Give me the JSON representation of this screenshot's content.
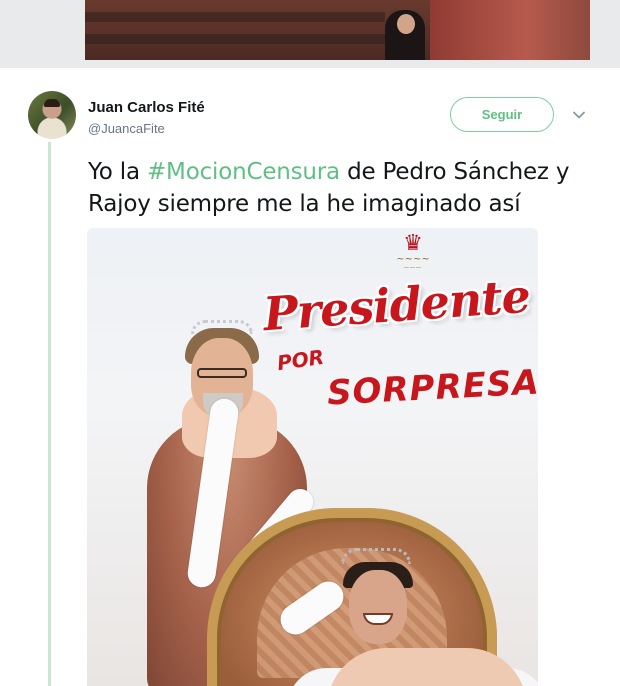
{
  "author": {
    "name": "Juan Carlos Fité",
    "handle": "@JuancaFite"
  },
  "actions": {
    "follow_label": "Seguir"
  },
  "tweet": {
    "text_before": "Yo la ",
    "hashtag": "#MocionCensura",
    "text_after": " de Pedro Sánchez y Rajoy siempre me la he imaginado así"
  },
  "poster": {
    "title_line1": "Presidente",
    "title_line2": "POR",
    "title_line3": "SORPRESA"
  },
  "colors": {
    "accent": "#5fbf84",
    "poster_title": "#c8161d"
  },
  "icons": {
    "more": "chevron-down-icon"
  }
}
